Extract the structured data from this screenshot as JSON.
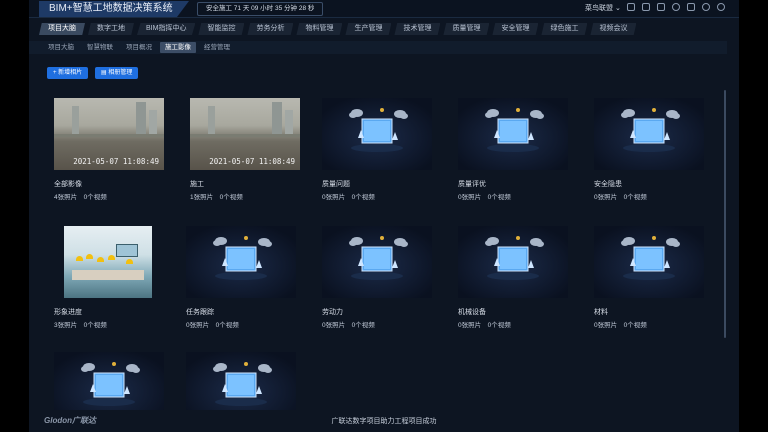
{
  "header": {
    "app_title": "BIM+智慧工地数据决策系统",
    "safety_text": "安全施工 71 天 09 小时 35 分钟 28 秒",
    "user_name": "菜鸟联盟"
  },
  "main_nav": [
    {
      "label": "项目大脑",
      "active": true
    },
    {
      "label": "数字工地",
      "active": false
    },
    {
      "label": "BIM指挥中心",
      "active": false
    },
    {
      "label": "智能监控",
      "active": false
    },
    {
      "label": "劳务分析",
      "active": false
    },
    {
      "label": "物料管理",
      "active": false
    },
    {
      "label": "生产管理",
      "active": false
    },
    {
      "label": "技术管理",
      "active": false
    },
    {
      "label": "质量管理",
      "active": false
    },
    {
      "label": "安全管理",
      "active": false
    },
    {
      "label": "绿色施工",
      "active": false
    },
    {
      "label": "视频会议",
      "active": false
    }
  ],
  "sub_nav": [
    {
      "label": "项目大脑",
      "active": false
    },
    {
      "label": "智慧物联",
      "active": false
    },
    {
      "label": "项目概况",
      "active": false
    },
    {
      "label": "施工影像",
      "active": true
    },
    {
      "label": "经营管理",
      "active": false
    }
  ],
  "toolbar": {
    "new_album_label": "+ 新增相片",
    "album_manage_label": "相册管理"
  },
  "albums": [
    {
      "name": "全部影像",
      "counts": "4张照片　0个视频",
      "timestamp": "2021-05-07 11:08:49"
    },
    {
      "name": "施工",
      "counts": "1张照片　0个视频",
      "timestamp": "2021-05-07 11:08:49"
    },
    {
      "name": "质量问题",
      "counts": "0张照片　0个视频"
    },
    {
      "name": "质量评优",
      "counts": "0张照片　0个视频"
    },
    {
      "name": "安全隐患",
      "counts": "0张照片　0个视频"
    },
    {
      "name": "形象进度",
      "counts": "3张照片　0个视频"
    },
    {
      "name": "任务跟踪",
      "counts": "0张照片　0个视频"
    },
    {
      "name": "劳动力",
      "counts": "0张照片　0个视频"
    },
    {
      "name": "机械设备",
      "counts": "0张照片　0个视频"
    },
    {
      "name": "材料",
      "counts": "0张照片　0个视频"
    },
    {
      "name": "",
      "counts": ""
    },
    {
      "name": "",
      "counts": ""
    }
  ],
  "footer": {
    "brand": "Glodon广联达",
    "slogan": "广联达数字项目助力工程项目成功"
  }
}
